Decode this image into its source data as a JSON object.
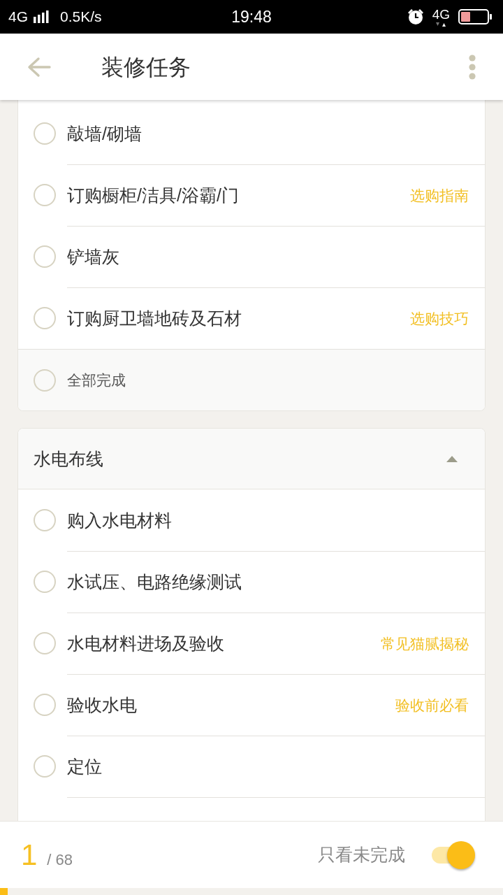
{
  "status_bar": {
    "network": "4G",
    "speed": "0.5K/s",
    "time": "19:48",
    "data_network": "4G"
  },
  "header": {
    "title": "装修任务"
  },
  "sections": [
    {
      "tasks": [
        {
          "label": "敲墙/砌墙",
          "checked": false
        },
        {
          "label": "订购橱柜/洁具/浴霸/门",
          "checked": false,
          "link": "选购指南"
        },
        {
          "label": "铲墙灰",
          "checked": false
        },
        {
          "label": "订购厨卫墙地砖及石材",
          "checked": false,
          "link": "选购技巧"
        }
      ],
      "complete_all": {
        "label": "全部完成",
        "checked": false
      }
    },
    {
      "title": "水电布线",
      "expanded": true,
      "tasks": [
        {
          "label": "购入水电材料",
          "checked": false
        },
        {
          "label": "水试压、电路绝缘测试",
          "checked": false
        },
        {
          "label": "水电材料进场及验收",
          "checked": false,
          "link": "常见猫腻揭秘"
        },
        {
          "label": "验收水电",
          "checked": false,
          "link": "验收前必看"
        },
        {
          "label": "定位",
          "checked": false
        }
      ]
    }
  ],
  "footer": {
    "done": "1",
    "total": "/ 68",
    "filter_label": "只看未完成",
    "filter_on": true,
    "progress": {
      "level": 0.0147
    }
  }
}
